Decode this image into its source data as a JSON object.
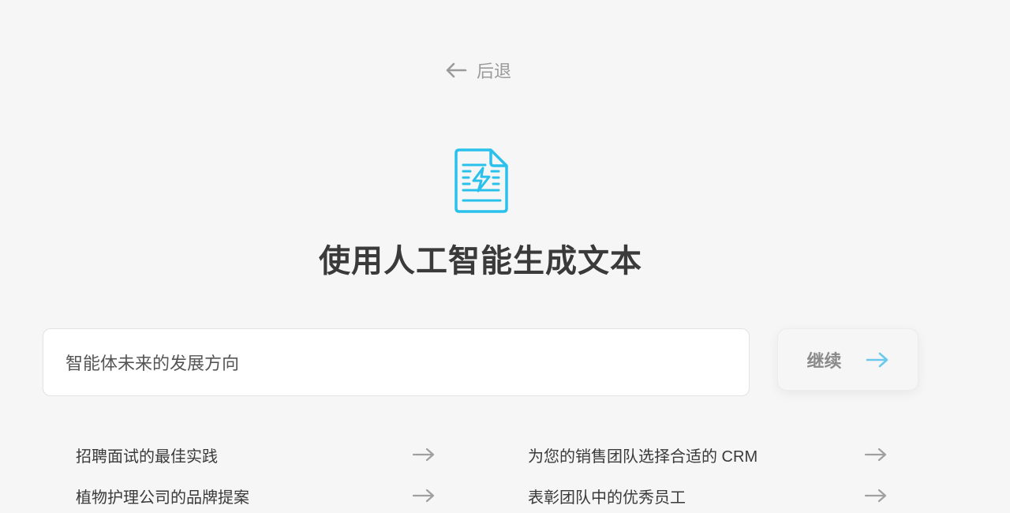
{
  "back": {
    "label": "后退",
    "icon": "arrow-left-icon"
  },
  "hero": {
    "icon": "document-lightning-icon",
    "accent": "#29c1ec"
  },
  "title": "使用人工智能生成文本",
  "prompt": {
    "value": "智能体未来的发展方向"
  },
  "continue": {
    "label": "继续",
    "icon": "arrow-right-icon",
    "icon_color": "#6cc9ea"
  },
  "suggestions": [
    {
      "label": "招聘面试的最佳实践"
    },
    {
      "label": "为您的销售团队选择合适的 CRM"
    },
    {
      "label": "植物护理公司的品牌提案"
    },
    {
      "label": "表彰团队中的优秀员工"
    }
  ]
}
